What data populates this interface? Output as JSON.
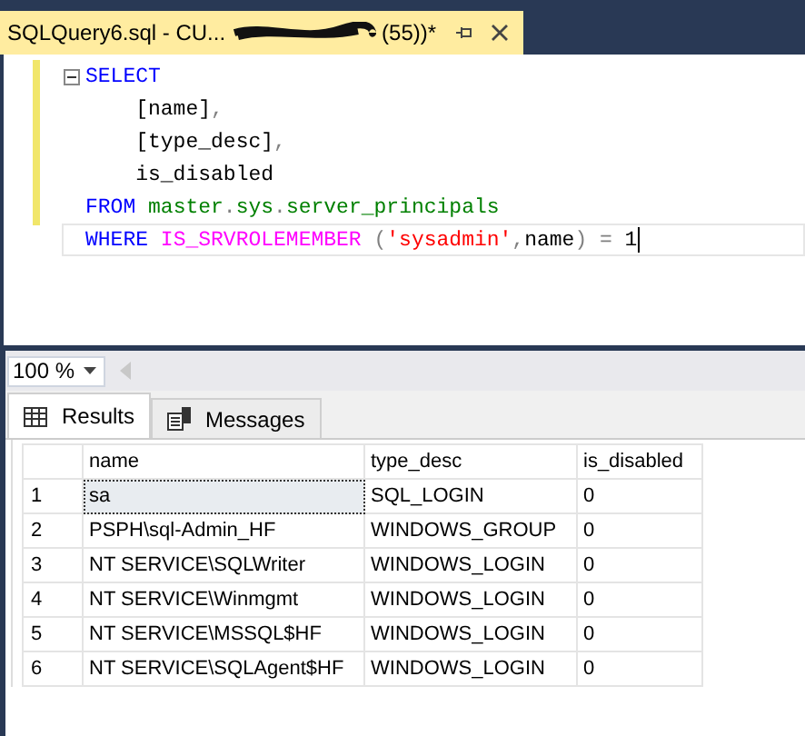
{
  "document_tab": {
    "title_start": "SQLQuery6.sql - CU...",
    "title_end": "(55))*",
    "redacted": true,
    "pinned": false
  },
  "editor": {
    "lines": [
      {
        "current": false,
        "collapsible": true,
        "tokens": [
          {
            "kind": "keyword",
            "text": "SELECT"
          }
        ]
      },
      {
        "current": false,
        "collapsible": false,
        "tokens": [
          {
            "kind": "plain",
            "text": "    [name]"
          },
          {
            "kind": "operator",
            "text": ","
          }
        ]
      },
      {
        "current": false,
        "collapsible": false,
        "tokens": [
          {
            "kind": "plain",
            "text": "    [type_desc]"
          },
          {
            "kind": "operator",
            "text": ","
          }
        ]
      },
      {
        "current": false,
        "collapsible": false,
        "tokens": [
          {
            "kind": "plain",
            "text": "    is_disabled"
          }
        ]
      },
      {
        "current": false,
        "collapsible": false,
        "tokens": [
          {
            "kind": "keyword",
            "text": "FROM"
          },
          {
            "kind": "object",
            "text": " master"
          },
          {
            "kind": "operator",
            "text": "."
          },
          {
            "kind": "object",
            "text": "sys"
          },
          {
            "kind": "operator",
            "text": "."
          },
          {
            "kind": "object",
            "text": "server_principals"
          }
        ]
      },
      {
        "current": true,
        "collapsible": false,
        "tokens": [
          {
            "kind": "keyword",
            "text": "WHERE"
          },
          {
            "kind": "function",
            "text": " IS_SRVROLEMEMBER"
          },
          {
            "kind": "operator",
            "text": " ("
          },
          {
            "kind": "string",
            "text": "'sysadmin'"
          },
          {
            "kind": "operator",
            "text": ","
          },
          {
            "kind": "plain",
            "text": "name"
          },
          {
            "kind": "operator",
            "text": ")"
          },
          {
            "kind": "operator",
            "text": " ="
          },
          {
            "kind": "plain",
            "text": " 1"
          }
        ]
      }
    ]
  },
  "zoom": {
    "value": "100 %"
  },
  "result_tabs": [
    {
      "label": "Results",
      "kind": "grid",
      "selected": true
    },
    {
      "label": "Messages",
      "kind": "messages",
      "selected": false
    }
  ],
  "table": {
    "columns": [
      "name",
      "type_desc",
      "is_disabled"
    ],
    "rows": [
      {
        "number": "1",
        "cells": [
          "sa",
          "SQL_LOGIN",
          "0"
        ],
        "selected": true
      },
      {
        "number": "2",
        "cells": [
          "PSPH\\sql-Admin_HF",
          "WINDOWS_GROUP",
          "0"
        ],
        "selected": false
      },
      {
        "number": "3",
        "cells": [
          "NT SERVICE\\SQLWriter",
          "WINDOWS_LOGIN",
          "0"
        ],
        "selected": false
      },
      {
        "number": "4",
        "cells": [
          "NT SERVICE\\Winmgmt",
          "WINDOWS_LOGIN",
          "0"
        ],
        "selected": false
      },
      {
        "number": "5",
        "cells": [
          "NT SERVICE\\MSSQL$HF",
          "WINDOWS_LOGIN",
          "0"
        ],
        "selected": false
      },
      {
        "number": "6",
        "cells": [
          "NT SERVICE\\SQLAgent$HF",
          "WINDOWS_LOGIN",
          "0"
        ],
        "selected": false
      }
    ]
  }
}
